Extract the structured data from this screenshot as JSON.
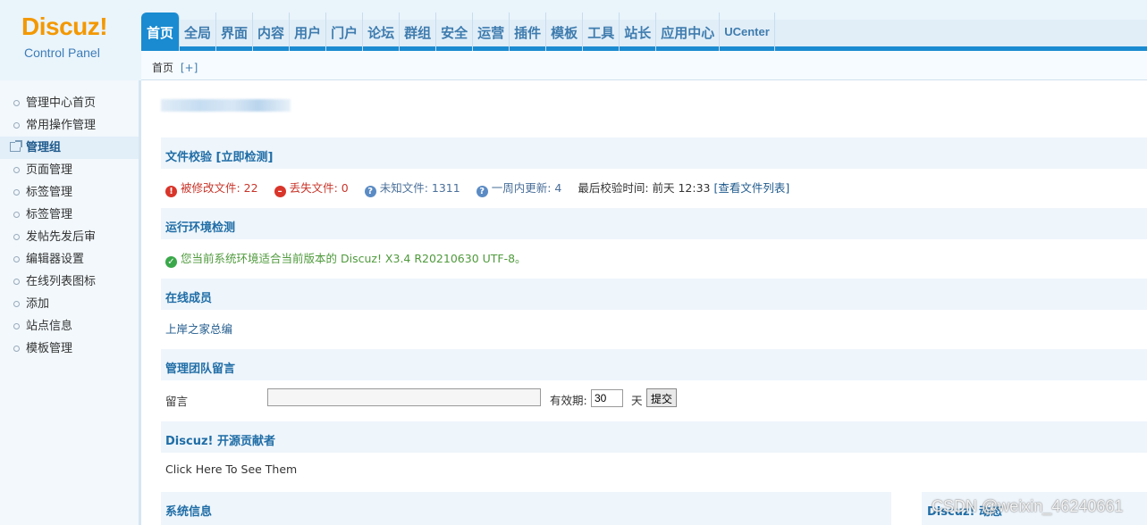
{
  "logo": {
    "brand": "Discuz!",
    "subtitle": "Control Panel"
  },
  "topnav": {
    "items": [
      "首页",
      "全局",
      "界面",
      "内容",
      "用户",
      "门户",
      "论坛",
      "群组",
      "安全",
      "运营",
      "插件",
      "模板",
      "工具",
      "站长",
      "应用中心",
      "UCenter"
    ],
    "active_index": 0
  },
  "breadcrumb": {
    "home": "首页",
    "add": "[+]"
  },
  "sidebar": {
    "items": [
      {
        "label": "管理中心首页"
      },
      {
        "label": "常用操作管理"
      },
      {
        "label": "管理组",
        "active": true
      },
      {
        "label": "页面管理"
      },
      {
        "label": "标签管理"
      },
      {
        "label": "标签管理"
      },
      {
        "label": "发帖先发后审"
      },
      {
        "label": "编辑器设置"
      },
      {
        "label": "在线列表图标"
      },
      {
        "label": "添加"
      },
      {
        "label": "站点信息"
      },
      {
        "label": "模板管理"
      }
    ]
  },
  "file_check": {
    "title": "文件校验",
    "action": "[立即检测]",
    "modified": "被修改文件: 22",
    "missing": "丢失文件: 0",
    "unknown": "未知文件: 1311",
    "updated_week": "一周内更新: 4",
    "last_check_label": "最后校验时间: 前天 12:33",
    "view_list": "[查看文件列表]"
  },
  "env_check": {
    "title": "运行环境检测",
    "message": "您当前系统环境适合当前版本的 Discuz! X3.4 R20210630 UTF-8。"
  },
  "online": {
    "title": "在线成员",
    "members": "上岸之家总编"
  },
  "team_message": {
    "title": "管理团队留言",
    "label": "留言",
    "message_value": "",
    "expiry_label": "有效期:",
    "expiry_value": "30",
    "unit": "天",
    "submit": "提交"
  },
  "contributors": {
    "title": "Discuz! 开源贡献者",
    "link": "Click Here To See Them"
  },
  "system_info": {
    "title": "系统信息"
  },
  "right_panel": {
    "title": "Discuz! 动态"
  },
  "watermark": "CSDN @weixin_46240661",
  "colors": {
    "accent": "#1a8bd1",
    "logo": "#f39800",
    "section_title": "#1f6da6"
  }
}
